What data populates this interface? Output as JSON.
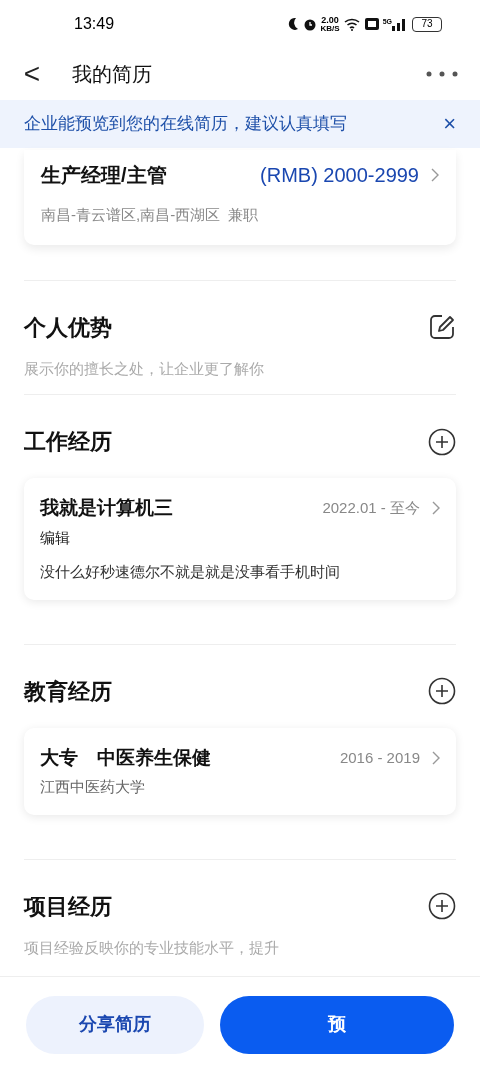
{
  "status_bar": {
    "time": "13:49",
    "speed": "2.00",
    "speed_unit": "KB/S",
    "network": "5G",
    "battery": "73"
  },
  "header": {
    "back": "<",
    "title": "我的简历"
  },
  "banner": {
    "text": "企业能预览到您的在线简历，建议认真填写",
    "close": "×"
  },
  "job_intent": {
    "title": "生产经理/主管",
    "salary": "(RMB) 2000-2999",
    "details": "南昌-青云谱区,南昌-西湖区  兼职"
  },
  "sections": [
    {
      "kind": "edit",
      "title": "个人优势",
      "hint": "展示你的擅长之处，让企业更了解你"
    },
    {
      "kind": "add",
      "title": "工作经历",
      "entries": [
        {
          "title": "我就是计算机三",
          "date": "2022.01 - 至今",
          "subtitle": "编辑",
          "description": "没什么好秒速德尔不就是就是没事看手机时间"
        }
      ]
    },
    {
      "kind": "add",
      "title": "教育经历",
      "entries": [
        {
          "title": "大专　中医养生保健",
          "date": "2016 - 2019",
          "subtitle": "江西中医药大学"
        }
      ]
    },
    {
      "kind": "add",
      "title": "项目经历",
      "hint": "项目经验反映你的专业技能水平，提升"
    }
  ],
  "buttons": [
    {
      "label": "分享简历",
      "primary": false
    },
    {
      "label": "预",
      "primary": true
    }
  ]
}
